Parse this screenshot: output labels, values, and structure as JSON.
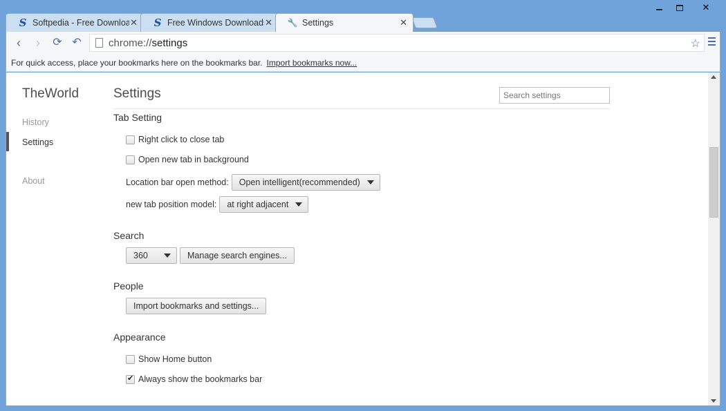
{
  "window": {
    "controls": {
      "minimize": "minimize",
      "maximize": "maximize",
      "close": "✕"
    }
  },
  "tabs": [
    {
      "title": "Softpedia - Free Download",
      "icon": "S",
      "close": "✕"
    },
    {
      "title": "Free Windows Downloads",
      "icon": "S",
      "close": "✕"
    },
    {
      "title": "Settings",
      "icon": "🔧",
      "close": "✕"
    }
  ],
  "toolbar": {
    "url_scheme": "chrome://",
    "url_path": "settings",
    "star_icon": "☆"
  },
  "bookmarks_bar": {
    "message": "For quick access, place your bookmarks here on the bookmarks bar.",
    "import_link": "Import bookmarks now..."
  },
  "sidebar": {
    "brand": "TheWorld",
    "items": [
      {
        "label": "History"
      },
      {
        "label": "Settings"
      },
      {
        "label": "About"
      }
    ]
  },
  "main": {
    "title": "Settings",
    "search_placeholder": "Search settings",
    "tab_setting": {
      "title": "Tab Setting",
      "right_click_close": "Right click to close tab",
      "open_background": "Open new tab in background",
      "location_label": "Location bar open method:",
      "location_value": "Open intelligent(recommended)",
      "position_label": "new tab position model:",
      "position_value": "at right adjacent"
    },
    "search": {
      "title": "Search",
      "engine_value": "360",
      "manage_button": "Manage search engines..."
    },
    "people": {
      "title": "People",
      "import_button": "Import bookmarks and settings..."
    },
    "appearance": {
      "title": "Appearance",
      "show_home": "Show Home button",
      "show_home_checked": false,
      "always_bookmarks": "Always show the bookmarks bar",
      "always_bookmarks_checked": true
    }
  }
}
